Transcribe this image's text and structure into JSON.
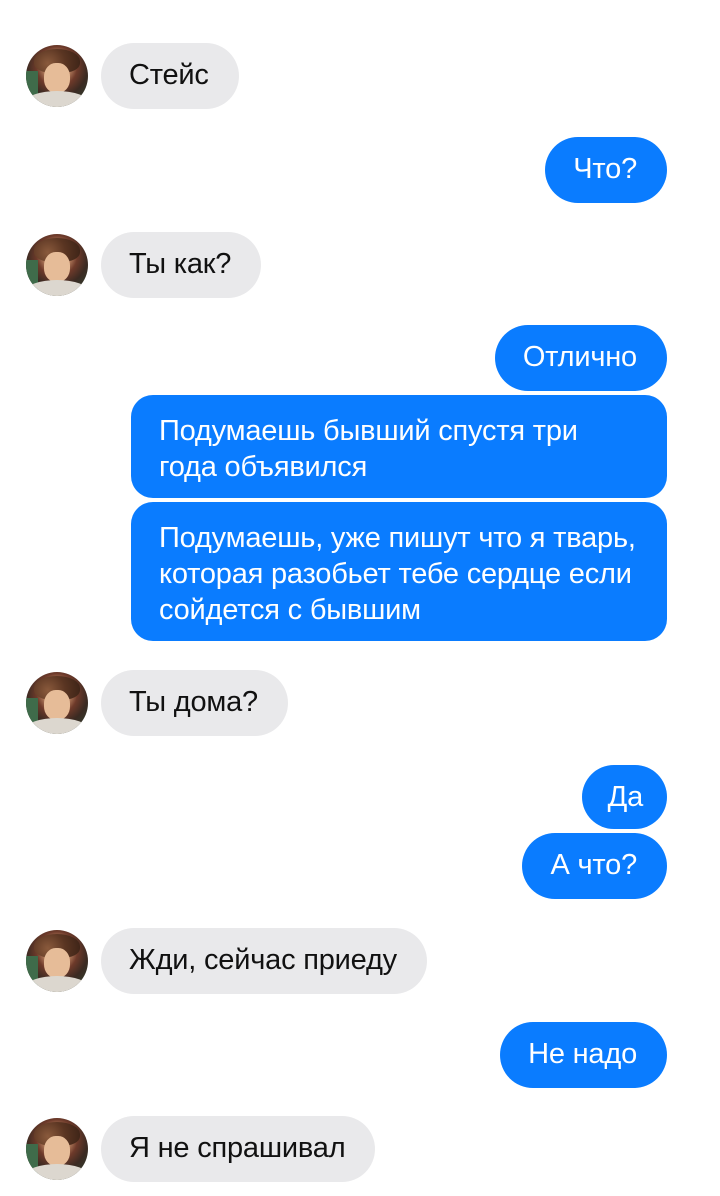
{
  "conversation": {
    "contact_avatar_icon": "contact-avatar-photo",
    "colors": {
      "incoming_bubble": "#e9e9eb",
      "outgoing_bubble": "#0a7cff",
      "outgoing_text": "#ffffff",
      "incoming_text": "#111111"
    },
    "messages": [
      {
        "from": "contact",
        "text": "Стейс"
      },
      {
        "from": "me",
        "text": "Что?"
      },
      {
        "from": "contact",
        "text": "Ты как?"
      },
      {
        "from": "me",
        "text": "Отлично"
      },
      {
        "from": "me",
        "text": "Подумаешь бывший спустя три года объявился"
      },
      {
        "from": "me",
        "text": "Подумаешь, уже пишут что я тварь, которая разобьет тебе сердце если сойдется с бывшим"
      },
      {
        "from": "contact",
        "text": "Ты дома?"
      },
      {
        "from": "me",
        "text": "Да"
      },
      {
        "from": "me",
        "text": "А что?"
      },
      {
        "from": "contact",
        "text": "Жди, сейчас приеду"
      },
      {
        "from": "me",
        "text": "Не надо"
      },
      {
        "from": "contact",
        "text": "Я не спрашивал"
      }
    ]
  }
}
